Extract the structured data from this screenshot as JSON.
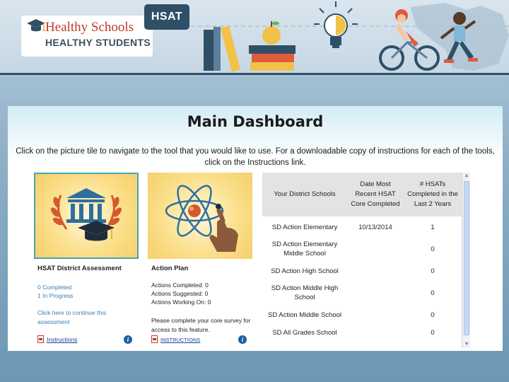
{
  "banner": {
    "logo_line1": "Healthy Schools",
    "logo_line2": "HEALTHY STUDENTS",
    "badge": "HSAT"
  },
  "dashboard": {
    "title": "Main Dashboard",
    "instructions": "Click on the picture tile to navigate to the tool that you would like to use. For a downloadable copy of instructions for each of the tools, click on the Instructions link."
  },
  "tiles": [
    {
      "title": "HSAT District Assessment",
      "completed": "0 Completed",
      "in_progress": "1 In Progress",
      "continue_line1": "Click here to continue this",
      "continue_line2": "assessment",
      "instructions_label": "Instructions",
      "info": "i"
    },
    {
      "title": "Action Plan",
      "actions_completed": "Actions Completed: 0",
      "actions_suggested": "Actions Suggested: 0",
      "actions_working": "Actions Working On: 0",
      "note_line1": "Please complete your core survey for",
      "note_line2": "access to this feature.",
      "instructions_label": "INSTRUCTIONS",
      "info": "i"
    }
  ],
  "schools_table": {
    "headers": [
      "Your District Schools",
      "Date Most Recent HSAT Core Completed",
      "# HSATs Completed in the Last 2 Years"
    ],
    "rows": [
      [
        "SD Action Elementary",
        "10/13/2014",
        "1"
      ],
      [
        "SD Action Elementary Middle School",
        "",
        "0"
      ],
      [
        "SD Action High School",
        "",
        "0"
      ],
      [
        "SD Action Middle High School",
        "",
        "0"
      ],
      [
        "SD Action Middle School",
        "",
        "0"
      ],
      [
        "SD All Grades School",
        "",
        "0"
      ]
    ]
  },
  "colors": {
    "accent": "#2f4f66",
    "logo_red": "#c0392b",
    "link_blue": "#3b7fb3",
    "tile_border": "#4aa3b5"
  },
  "icons": [
    "graduation-cap-icon",
    "books-apple-icon",
    "lightbulb-icon",
    "cyclist-runner-icon",
    "university-icon",
    "atom-icon",
    "pdf-icon",
    "info-icon"
  ]
}
